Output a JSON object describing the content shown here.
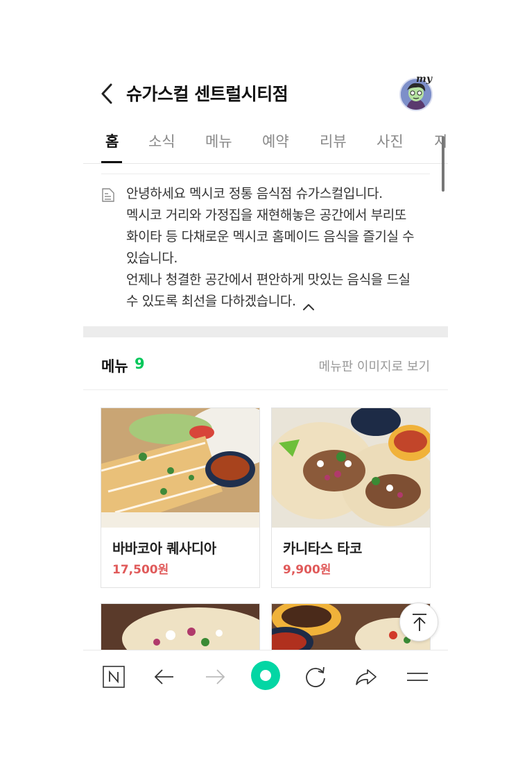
{
  "header": {
    "title": "슈가스컬 센트럴시티점",
    "avatar_badge": "my"
  },
  "tabs": [
    {
      "label": "홈",
      "active": true
    },
    {
      "label": "소식",
      "active": false
    },
    {
      "label": "메뉴",
      "active": false
    },
    {
      "label": "예약",
      "active": false
    },
    {
      "label": "리뷰",
      "active": false
    },
    {
      "label": "사진",
      "active": false
    },
    {
      "label": "지",
      "active": false
    }
  ],
  "description": {
    "lines": [
      "안녕하세요 멕시코 정통 음식점 슈가스컬입니다.",
      "멕시코 거리와 가정집을 재현해놓은 공간에서 부리또",
      "화이타 등 다채로운 멕시코 홈메이드 음식을 즐기실 수",
      "있습니다.",
      "언제나 청결한 공간에서 편안하게 맛있는 음식을 드실",
      "수 있도록 최선을 다하겠습니다."
    ]
  },
  "menu": {
    "title": "메뉴",
    "count": "9",
    "board_link": "메뉴판 이미지로 보기",
    "items": [
      {
        "name": "바바코아 퀘사디아",
        "price": "17,500원"
      },
      {
        "name": "카니타스 타코",
        "price": "9,900원"
      },
      {
        "name": "",
        "price": ""
      },
      {
        "name": "",
        "price": ""
      }
    ]
  },
  "colors": {
    "accent_green": "#03c75a",
    "price_red": "#e05a5a"
  },
  "icons": {
    "back": "chevron-left-icon",
    "description": "document-icon",
    "collapse": "chevron-up-icon",
    "top": "arrow-up-to-top-icon",
    "nav": [
      "naver-home-icon",
      "arrow-left-icon",
      "arrow-right-icon",
      "green-dot-icon",
      "refresh-icon",
      "share-icon",
      "hamburger-menu-icon"
    ]
  }
}
